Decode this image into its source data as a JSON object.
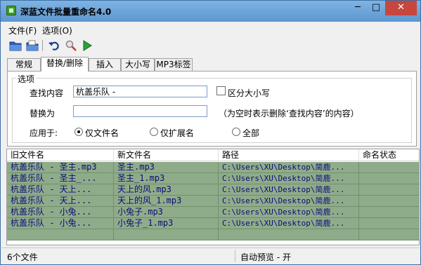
{
  "window": {
    "title": "深蓝文件批量重命名4.0",
    "minimize": "─",
    "maximize": "□",
    "close": "✕"
  },
  "menu": {
    "file": "文件(F)",
    "options": "选项(O)"
  },
  "toolbar": {
    "icons": [
      "open-folder-icon",
      "open-file-icon",
      "undo-icon",
      "preview-icon",
      "run-icon"
    ]
  },
  "tabs": [
    {
      "label": "常规",
      "active": false
    },
    {
      "label": "替换/删除",
      "active": true
    },
    {
      "label": "插入",
      "active": false
    },
    {
      "label": "大小写",
      "active": false
    },
    {
      "label": "MP3标签",
      "active": false
    }
  ],
  "options": {
    "group_title": "选项",
    "find_label": "查找内容",
    "find_value": "杭盖乐队 -",
    "case_label": "区分大小写",
    "replace_label": "替换为",
    "replace_value": "",
    "hint": "（为空时表示删除‘查找内容’的内容）",
    "apply_label": "应用于:",
    "radio_filename": "仅文件名",
    "radio_ext": "仅扩展名",
    "radio_all": "全部"
  },
  "list": {
    "headers": [
      "旧文件名",
      "新文件名",
      "路径",
      "命名状态"
    ],
    "rows": [
      [
        "杭盖乐队 - 圣主.mp3",
        "圣主.mp3",
        "C:\\Users\\XU\\Desktop\\简鹿...",
        ""
      ],
      [
        "杭盖乐队 - 圣主_...",
        "圣主_1.mp3",
        "C:\\Users\\XU\\Desktop\\简鹿...",
        ""
      ],
      [
        "杭盖乐队 - 天上...",
        "天上的风.mp3",
        "C:\\Users\\XU\\Desktop\\简鹿...",
        ""
      ],
      [
        "杭盖乐队 - 天上...",
        "天上的风_1.mp3",
        "C:\\Users\\XU\\Desktop\\简鹿...",
        ""
      ],
      [
        "杭盖乐队 - 小兔...",
        "小兔子.mp3",
        "C:\\Users\\XU\\Desktop\\简鹿...",
        ""
      ],
      [
        "杭盖乐队 - 小兔...",
        "小兔子_1.mp3",
        "C:\\Users\\XU\\Desktop\\简鹿...",
        ""
      ]
    ]
  },
  "status": {
    "count": "6个文件",
    "preview": "自动预览 - 开"
  },
  "colors": {
    "row_bg": "#8fac8a",
    "row_text": "#0b0b7a",
    "titlebar": "#6fa3d1",
    "close": "#c7463d"
  }
}
